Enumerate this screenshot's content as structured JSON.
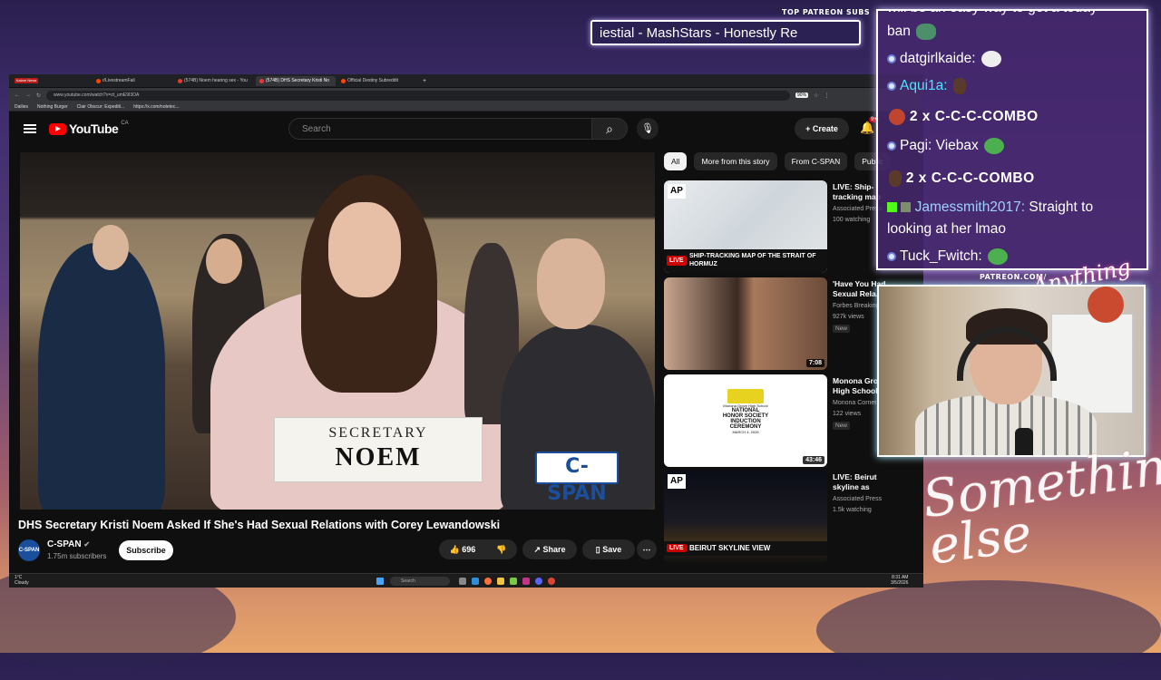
{
  "overlay": {
    "patreon_label": "TOP PATREON SUBS",
    "ticker_text": "iestial - MashStars - Honestly Re",
    "patreon_url": "PATREON.COM/",
    "anything_logo": "Anything else",
    "signature": "Something else"
  },
  "browser": {
    "tabs": [
      {
        "label": "Kalam News",
        "type": "news"
      },
      {
        "label": "r/LivestreamFail"
      },
      {
        "label": "(574B) Noem hearing sex - You"
      },
      {
        "label": "(574B) DHS Secretary Kristi No",
        "active": true
      },
      {
        "label": "Official Destiny Subreddit"
      }
    ],
    "address": "www.youtube.com/watch?v=zt_umE9I3OA",
    "zoom": "90%",
    "bookmarks": [
      "Dailies",
      "Nothing Burger",
      "Clair Obscur: Expediti...",
      "https://x.com/notetec..."
    ]
  },
  "youtube": {
    "logo_text": "YouTube",
    "country_code": "CA",
    "search_placeholder": "Search",
    "create_label": "Create",
    "notification_count": "9+",
    "video": {
      "plate_line1": "SECRETARY",
      "plate_line2": "NOEM",
      "bug": "C-SPAN",
      "title": "DHS Secretary Kristi Noem Asked If She's Had Sexual Relations with Corey Lewandowski",
      "channel": "C-SPAN",
      "subscribers": "1.75m subscribers",
      "subscribe_label": "Subscribe",
      "likes": "696",
      "share_label": "Share",
      "save_label": "Save",
      "channel_logo": "C-SPAN"
    },
    "chips": [
      {
        "label": "All",
        "selected": true
      },
      {
        "label": "More from this story"
      },
      {
        "label": "From C-SPAN"
      },
      {
        "label": "Public"
      }
    ],
    "recommendations": [
      {
        "title": "LIVE: Ship-tracking map of the Strait",
        "channel": "Associated Press",
        "meta": "100 watching",
        "overlay": "SHIP-TRACKING MAP OF THE STRAIT OF HORMUZ",
        "badge": "LIVE"
      },
      {
        "title": "'Have You Had Sexual Rela...",
        "channel": "Forbes Breaking",
        "meta": "927k views",
        "new": "New",
        "duration": "7:08"
      },
      {
        "title": "Monona Grove High School - National...",
        "channel": "Monona Cornerstone",
        "meta": "122 views",
        "new": "New",
        "duration": "43:46",
        "thumb_lines": [
          "Monona Grove High School",
          "NATIONAL",
          "HONOR SOCIETY",
          "INDUCTION",
          "CEREMONY",
          "MARCH 4, 2026"
        ]
      },
      {
        "title": "LIVE: Beirut skyline as Israeli military ...",
        "channel": "Associated Press",
        "meta": "1.5k watching",
        "overlay": "BEIRUT SKYLINE VIEW",
        "badge": "LIVE"
      }
    ]
  },
  "taskbar": {
    "weather_temp": "1°C",
    "weather_desc": "Cloudy",
    "search": "Search",
    "time": "8:31 AM",
    "date": "3/5/2026"
  },
  "chat": {
    "lines": [
      {
        "kind": "text",
        "text": "will be an easy way to get a today"
      },
      {
        "kind": "text",
        "text": "ban"
      },
      {
        "kind": "msg",
        "user": "datgirlkaide:",
        "text": ""
      },
      {
        "kind": "msg",
        "user": "Aqui1a:",
        "text": "",
        "usercolor": "#4fe3ff"
      },
      {
        "kind": "combo",
        "count": "2",
        "x": "x",
        "text": "C-C-C-COMBO"
      },
      {
        "kind": "msg",
        "user": "Pagi:",
        "text": "Viebax"
      },
      {
        "kind": "combo",
        "count": "2",
        "x": "x",
        "text": "C-C-C-COMBO"
      },
      {
        "kind": "msg",
        "user": "Jamessmith2017:",
        "text": "Straight to",
        "usercolor": "#9fd0ff"
      },
      {
        "kind": "text",
        "text": "looking at her lmao"
      },
      {
        "kind": "msg",
        "user": "Tuck_Fwitch:",
        "text": ""
      }
    ]
  },
  "colors": {
    "accent_red": "#ff0000",
    "chat_border": "#ffffff",
    "cspan_blue": "#1b4e9b"
  }
}
